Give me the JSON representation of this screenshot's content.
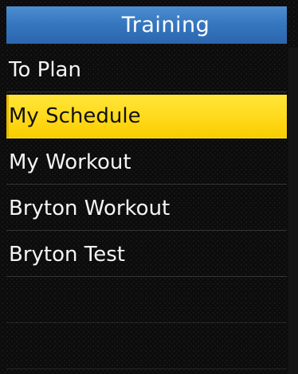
{
  "header": {
    "title": "Training"
  },
  "menu": {
    "items": [
      {
        "label": "To Plan",
        "selected": false
      },
      {
        "label": "My Schedule",
        "selected": true
      },
      {
        "label": "My Workout",
        "selected": false
      },
      {
        "label": "Bryton Workout",
        "selected": false
      },
      {
        "label": "Bryton Test",
        "selected": false
      }
    ]
  },
  "colors": {
    "header_blue": "#3677c0",
    "selection_yellow": "#ffd91a",
    "background": "#0c0c0c",
    "text_light": "#f4f4f4",
    "text_dark": "#111111"
  }
}
